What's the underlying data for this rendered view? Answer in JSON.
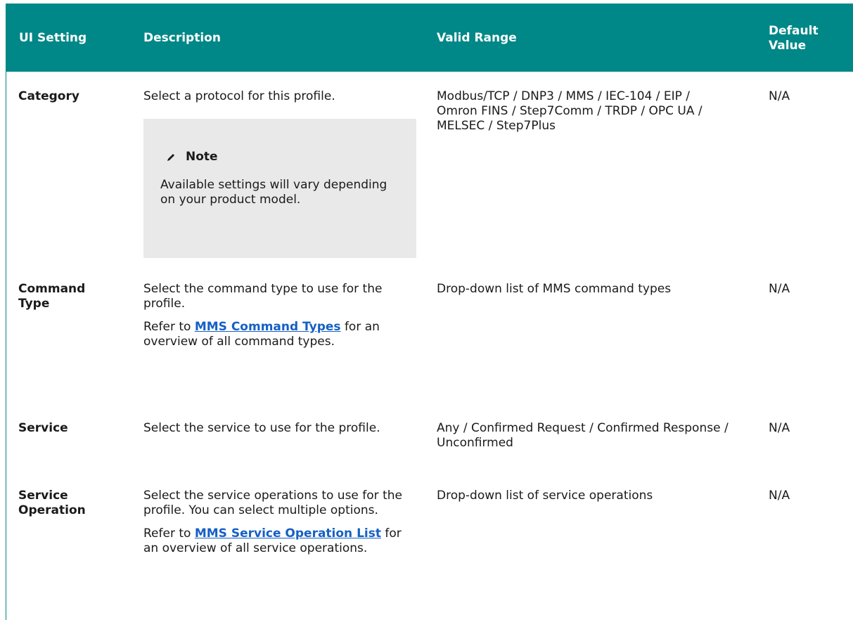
{
  "table": {
    "headers": {
      "setting": "UI Setting",
      "description": "Description",
      "range": "Valid Range",
      "default_line1": "Default",
      "default_line2": "Value"
    },
    "rows": [
      {
        "setting": "Category",
        "description": "Select a protocol for this profile.",
        "note_title": "Note",
        "note_body": "Available settings will vary depending on your product model.",
        "range": "Modbus/TCP / DNP3 / MMS / IEC-104 / EIP / Omron FINS / Step7Comm / TRDP / OPC UA / MELSEC / Step7Plus",
        "default": "N/A"
      },
      {
        "setting": "Command Type",
        "description": "Select the command type to use for the profile.",
        "refer_prefix": "Refer to ",
        "link": "MMS Command Types",
        "refer_suffix": " for an overview of all command types.",
        "range": "Drop-down list of MMS command types",
        "default": "N/A"
      },
      {
        "setting": "Service",
        "description": "Select the service to use for the profile.",
        "range": "Any / Confirmed Request / Confirmed Response / Unconfirmed",
        "default": "N/A"
      },
      {
        "setting": "Service Operation",
        "description": "Select the service operations to use for the profile. You can select multiple options.",
        "refer_prefix": "Refer to ",
        "link": "MMS Service Operation List",
        "refer_suffix": " for an overview of all service operations.",
        "range": "Drop-down list of service operations",
        "default": "N/A"
      }
    ]
  }
}
